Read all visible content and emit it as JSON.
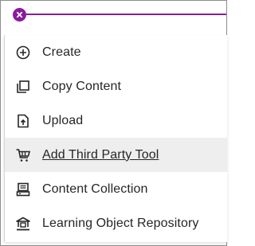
{
  "header": {
    "close_icon": "close-icon",
    "accent_color": "#8a1c9b"
  },
  "menu": {
    "items": [
      {
        "label": "Create",
        "icon": "plus-circle-icon"
      },
      {
        "label": "Copy Content",
        "icon": "copy-icon"
      },
      {
        "label": "Upload",
        "icon": "upload-icon"
      },
      {
        "label": "Add Third Party Tool",
        "icon": "cart-icon",
        "hovered": true
      },
      {
        "label": "Content Collection",
        "icon": "collection-icon"
      },
      {
        "label": "Learning Object Repository",
        "icon": "repository-icon"
      }
    ]
  }
}
